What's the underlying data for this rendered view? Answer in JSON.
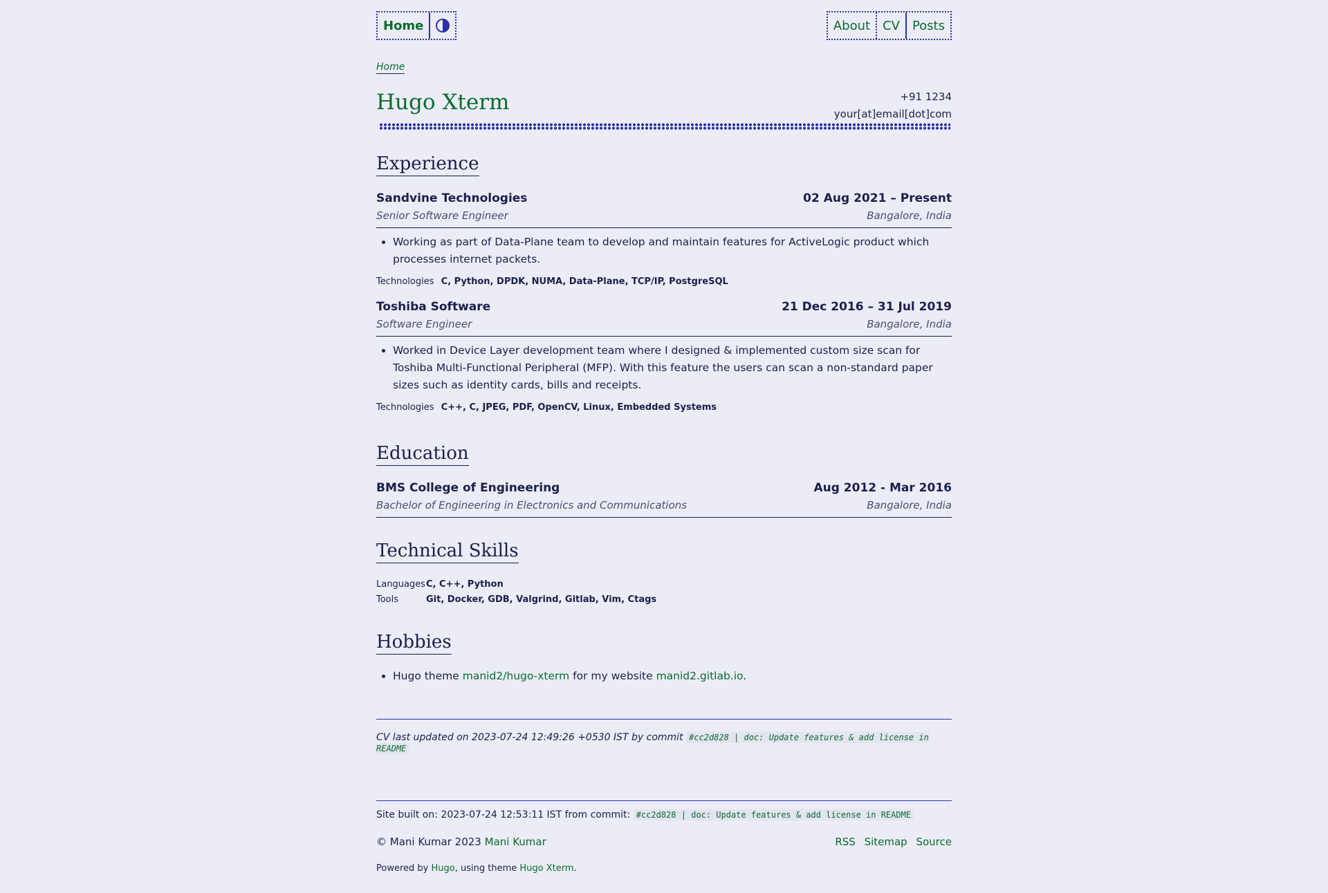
{
  "nav": {
    "home": "Home",
    "theme_icon": "contrast-icon",
    "about": "About",
    "cv": "CV",
    "posts": "Posts"
  },
  "breadcrumb": "Home",
  "header": {
    "name": "Hugo Xterm",
    "phone": "+91 1234",
    "email": "your[at]email[dot]com"
  },
  "experience": {
    "title": "Experience",
    "entries": [
      {
        "org": "Sandvine Technologies",
        "dates": "02 Aug 2021 – Present",
        "role": "Senior Software Engineer",
        "location": "Bangalore, India",
        "bullet": "Working as part of Data-Plane team to develop and maintain features for ActiveLogic product which processes internet packets.",
        "tech_label": "Technologies",
        "tech": "C, Python, DPDK, NUMA, Data-Plane, TCP/IP, PostgreSQL"
      },
      {
        "org": "Toshiba Software",
        "dates": "21 Dec 2016 – 31 Jul 2019",
        "role": "Software Engineer",
        "location": "Bangalore, India",
        "bullet": "Worked in Device Layer development team where I designed & implemented custom size scan for Toshiba Multi-Functional Peripheral (MFP). With this feature the users can scan a non-standard paper sizes such as identity cards, bills and receipts.",
        "tech_label": "Technologies",
        "tech": "C++, C, JPEG, PDF, OpenCV, Linux, Embedded Systems"
      }
    ]
  },
  "education": {
    "title": "Education",
    "org": "BMS College of Engineering",
    "dates": "Aug 2012 - Mar 2016",
    "degree": "Bachelor of Engineering in Electronics and Communications",
    "location": "Bangalore, India"
  },
  "skills": {
    "title": "Technical Skills",
    "languages_label": "Languages",
    "languages": "C, C++, Python",
    "tools_label": "Tools",
    "tools": "Git, Docker, GDB, Valgrind, Gitlab, Vim, Ctags"
  },
  "hobbies": {
    "title": "Hobbies",
    "pre": "Hugo theme ",
    "link1": "manid2/hugo-xterm",
    "mid": " for my website ",
    "link2": "manid2.gitlab.io",
    "post": "."
  },
  "cv_updated": {
    "text": "CV last updated on 2023-07-24 12:49:26 +0530 IST by commit",
    "commit": "#cc2d828 | doc: Update features & add license in README"
  },
  "footer": {
    "built": "Site built on: 2023-07-24 12:53:11 IST from commit:",
    "commit": "#cc2d828 | doc: Update features & add license in README",
    "copyright": "© Mani Kumar 2023 ",
    "author_link": "Mani Kumar",
    "rss": "RSS",
    "sitemap": "Sitemap",
    "source": "Source",
    "powered_pre": "Powered by ",
    "hugo": "Hugo",
    "powered_mid": ", using theme ",
    "theme": "Hugo Xterm",
    "powered_post": "."
  }
}
